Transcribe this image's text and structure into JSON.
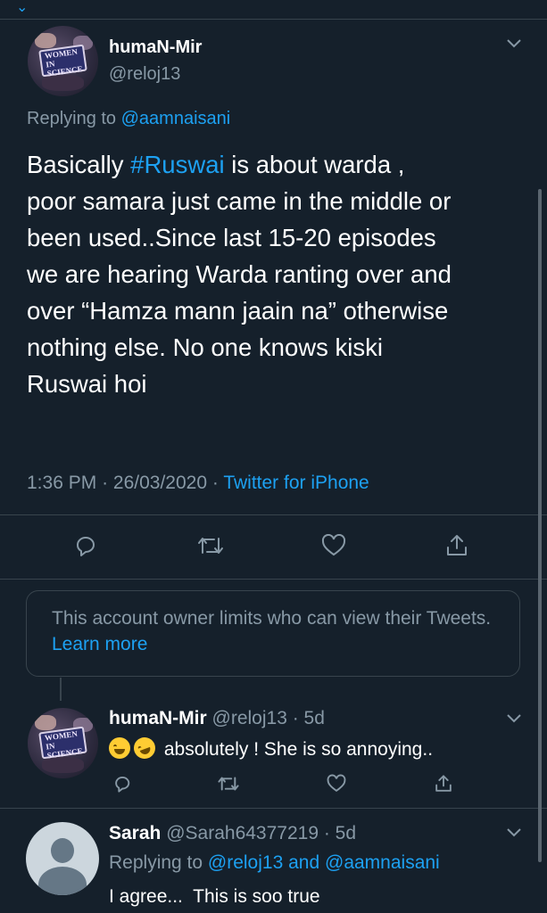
{
  "main_tweet": {
    "author_name": "humaN-Mir",
    "author_handle": "@reloj13",
    "avatar_sign_text": "WOMEN IN SCIENCE",
    "replying_prefix": "Replying to",
    "replying_to": "@aamnaisani",
    "text_before_tag": "Basically ",
    "hashtag": "#Ruswai",
    "text_after_tag": " is about warda ,\npoor samara just came in the middle or\nbeen used..Since last 15-20 episodes\nwe are hearing Warda ranting over and\nover “Hamza mann jaain na” otherwise\nnothing else. No one knows kiski\nRuswai hoi",
    "time": "1:36 PM",
    "date": "26/03/2020",
    "separator": "·",
    "source": "Twitter for iPhone"
  },
  "notice": {
    "text": "This account owner limits who can view their Tweets.",
    "link": "Learn more"
  },
  "reply1": {
    "author_name": "humaN-Mir",
    "author_handle": "@reloj13",
    "age": "· 5d",
    "text": "absolutely ! She is so annoying..",
    "emojis": [
      "face-with-tears-of-joy",
      "rolling-on-floor-laughing"
    ]
  },
  "reply2": {
    "author_name": "Sarah",
    "author_handle": "@Sarah64377219",
    "age": "· 5d",
    "replying_prefix": "Replying to",
    "replying_to_1": "@reloj13",
    "and": "and",
    "replying_to_2": "@aamnaisani",
    "text": "I agree...  This is soo true"
  },
  "colors": {
    "background": "#15202b",
    "accent": "#1da1f2",
    "muted": "#8899a6",
    "border": "#38444d"
  }
}
